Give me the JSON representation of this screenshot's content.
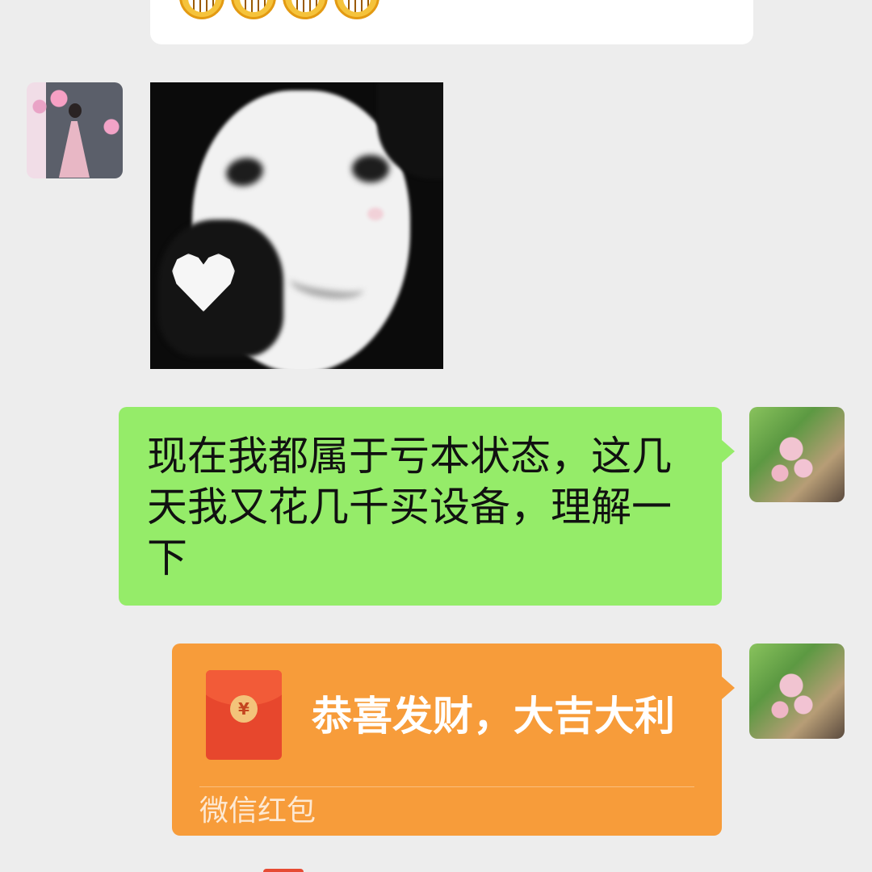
{
  "messages": {
    "top_partial": {
      "emoji_icons": [
        "grimace-emoji-icon",
        "grimace-emoji-icon",
        "grimace-emoji-icon",
        "grimace-emoji-icon"
      ]
    },
    "text_message": {
      "content": "现在我都属于亏本状态，这几天我又花几千买设备，理解一下"
    },
    "red_packet": {
      "title": "恭喜发财，大吉大利",
      "footer": "微信红包",
      "icon": "red-envelope-icon",
      "currency_symbol": "¥"
    }
  },
  "colors": {
    "background": "#ededed",
    "sent_bubble": "#95ec69",
    "red_packet_bubble": "#f79c3a",
    "red_packet_icon": "#e7472d"
  }
}
